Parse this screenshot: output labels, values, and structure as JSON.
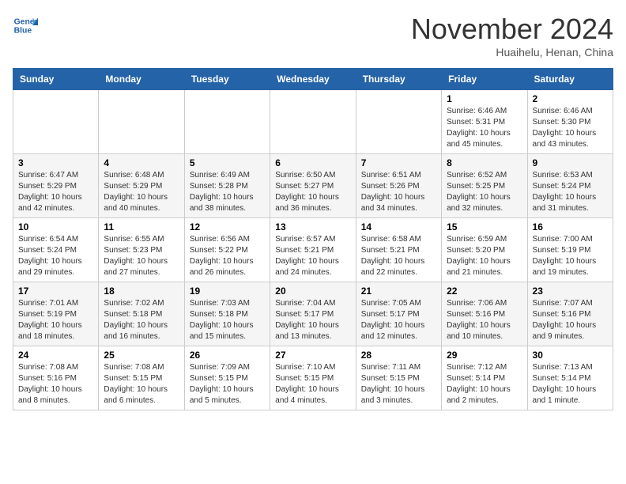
{
  "header": {
    "logo_line1": "General",
    "logo_line2": "Blue",
    "month": "November 2024",
    "location": "Huaihelu, Henan, China"
  },
  "weekdays": [
    "Sunday",
    "Monday",
    "Tuesday",
    "Wednesday",
    "Thursday",
    "Friday",
    "Saturday"
  ],
  "weeks": [
    [
      {
        "day": "",
        "info": ""
      },
      {
        "day": "",
        "info": ""
      },
      {
        "day": "",
        "info": ""
      },
      {
        "day": "",
        "info": ""
      },
      {
        "day": "",
        "info": ""
      },
      {
        "day": "1",
        "info": "Sunrise: 6:46 AM\nSunset: 5:31 PM\nDaylight: 10 hours\nand 45 minutes."
      },
      {
        "day": "2",
        "info": "Sunrise: 6:46 AM\nSunset: 5:30 PM\nDaylight: 10 hours\nand 43 minutes."
      }
    ],
    [
      {
        "day": "3",
        "info": "Sunrise: 6:47 AM\nSunset: 5:29 PM\nDaylight: 10 hours\nand 42 minutes."
      },
      {
        "day": "4",
        "info": "Sunrise: 6:48 AM\nSunset: 5:29 PM\nDaylight: 10 hours\nand 40 minutes."
      },
      {
        "day": "5",
        "info": "Sunrise: 6:49 AM\nSunset: 5:28 PM\nDaylight: 10 hours\nand 38 minutes."
      },
      {
        "day": "6",
        "info": "Sunrise: 6:50 AM\nSunset: 5:27 PM\nDaylight: 10 hours\nand 36 minutes."
      },
      {
        "day": "7",
        "info": "Sunrise: 6:51 AM\nSunset: 5:26 PM\nDaylight: 10 hours\nand 34 minutes."
      },
      {
        "day": "8",
        "info": "Sunrise: 6:52 AM\nSunset: 5:25 PM\nDaylight: 10 hours\nand 32 minutes."
      },
      {
        "day": "9",
        "info": "Sunrise: 6:53 AM\nSunset: 5:24 PM\nDaylight: 10 hours\nand 31 minutes."
      }
    ],
    [
      {
        "day": "10",
        "info": "Sunrise: 6:54 AM\nSunset: 5:24 PM\nDaylight: 10 hours\nand 29 minutes."
      },
      {
        "day": "11",
        "info": "Sunrise: 6:55 AM\nSunset: 5:23 PM\nDaylight: 10 hours\nand 27 minutes."
      },
      {
        "day": "12",
        "info": "Sunrise: 6:56 AM\nSunset: 5:22 PM\nDaylight: 10 hours\nand 26 minutes."
      },
      {
        "day": "13",
        "info": "Sunrise: 6:57 AM\nSunset: 5:21 PM\nDaylight: 10 hours\nand 24 minutes."
      },
      {
        "day": "14",
        "info": "Sunrise: 6:58 AM\nSunset: 5:21 PM\nDaylight: 10 hours\nand 22 minutes."
      },
      {
        "day": "15",
        "info": "Sunrise: 6:59 AM\nSunset: 5:20 PM\nDaylight: 10 hours\nand 21 minutes."
      },
      {
        "day": "16",
        "info": "Sunrise: 7:00 AM\nSunset: 5:19 PM\nDaylight: 10 hours\nand 19 minutes."
      }
    ],
    [
      {
        "day": "17",
        "info": "Sunrise: 7:01 AM\nSunset: 5:19 PM\nDaylight: 10 hours\nand 18 minutes."
      },
      {
        "day": "18",
        "info": "Sunrise: 7:02 AM\nSunset: 5:18 PM\nDaylight: 10 hours\nand 16 minutes."
      },
      {
        "day": "19",
        "info": "Sunrise: 7:03 AM\nSunset: 5:18 PM\nDaylight: 10 hours\nand 15 minutes."
      },
      {
        "day": "20",
        "info": "Sunrise: 7:04 AM\nSunset: 5:17 PM\nDaylight: 10 hours\nand 13 minutes."
      },
      {
        "day": "21",
        "info": "Sunrise: 7:05 AM\nSunset: 5:17 PM\nDaylight: 10 hours\nand 12 minutes."
      },
      {
        "day": "22",
        "info": "Sunrise: 7:06 AM\nSunset: 5:16 PM\nDaylight: 10 hours\nand 10 minutes."
      },
      {
        "day": "23",
        "info": "Sunrise: 7:07 AM\nSunset: 5:16 PM\nDaylight: 10 hours\nand 9 minutes."
      }
    ],
    [
      {
        "day": "24",
        "info": "Sunrise: 7:08 AM\nSunset: 5:16 PM\nDaylight: 10 hours\nand 8 minutes."
      },
      {
        "day": "25",
        "info": "Sunrise: 7:08 AM\nSunset: 5:15 PM\nDaylight: 10 hours\nand 6 minutes."
      },
      {
        "day": "26",
        "info": "Sunrise: 7:09 AM\nSunset: 5:15 PM\nDaylight: 10 hours\nand 5 minutes."
      },
      {
        "day": "27",
        "info": "Sunrise: 7:10 AM\nSunset: 5:15 PM\nDaylight: 10 hours\nand 4 minutes."
      },
      {
        "day": "28",
        "info": "Sunrise: 7:11 AM\nSunset: 5:15 PM\nDaylight: 10 hours\nand 3 minutes."
      },
      {
        "day": "29",
        "info": "Sunrise: 7:12 AM\nSunset: 5:14 PM\nDaylight: 10 hours\nand 2 minutes."
      },
      {
        "day": "30",
        "info": "Sunrise: 7:13 AM\nSunset: 5:14 PM\nDaylight: 10 hours\nand 1 minute."
      }
    ]
  ]
}
